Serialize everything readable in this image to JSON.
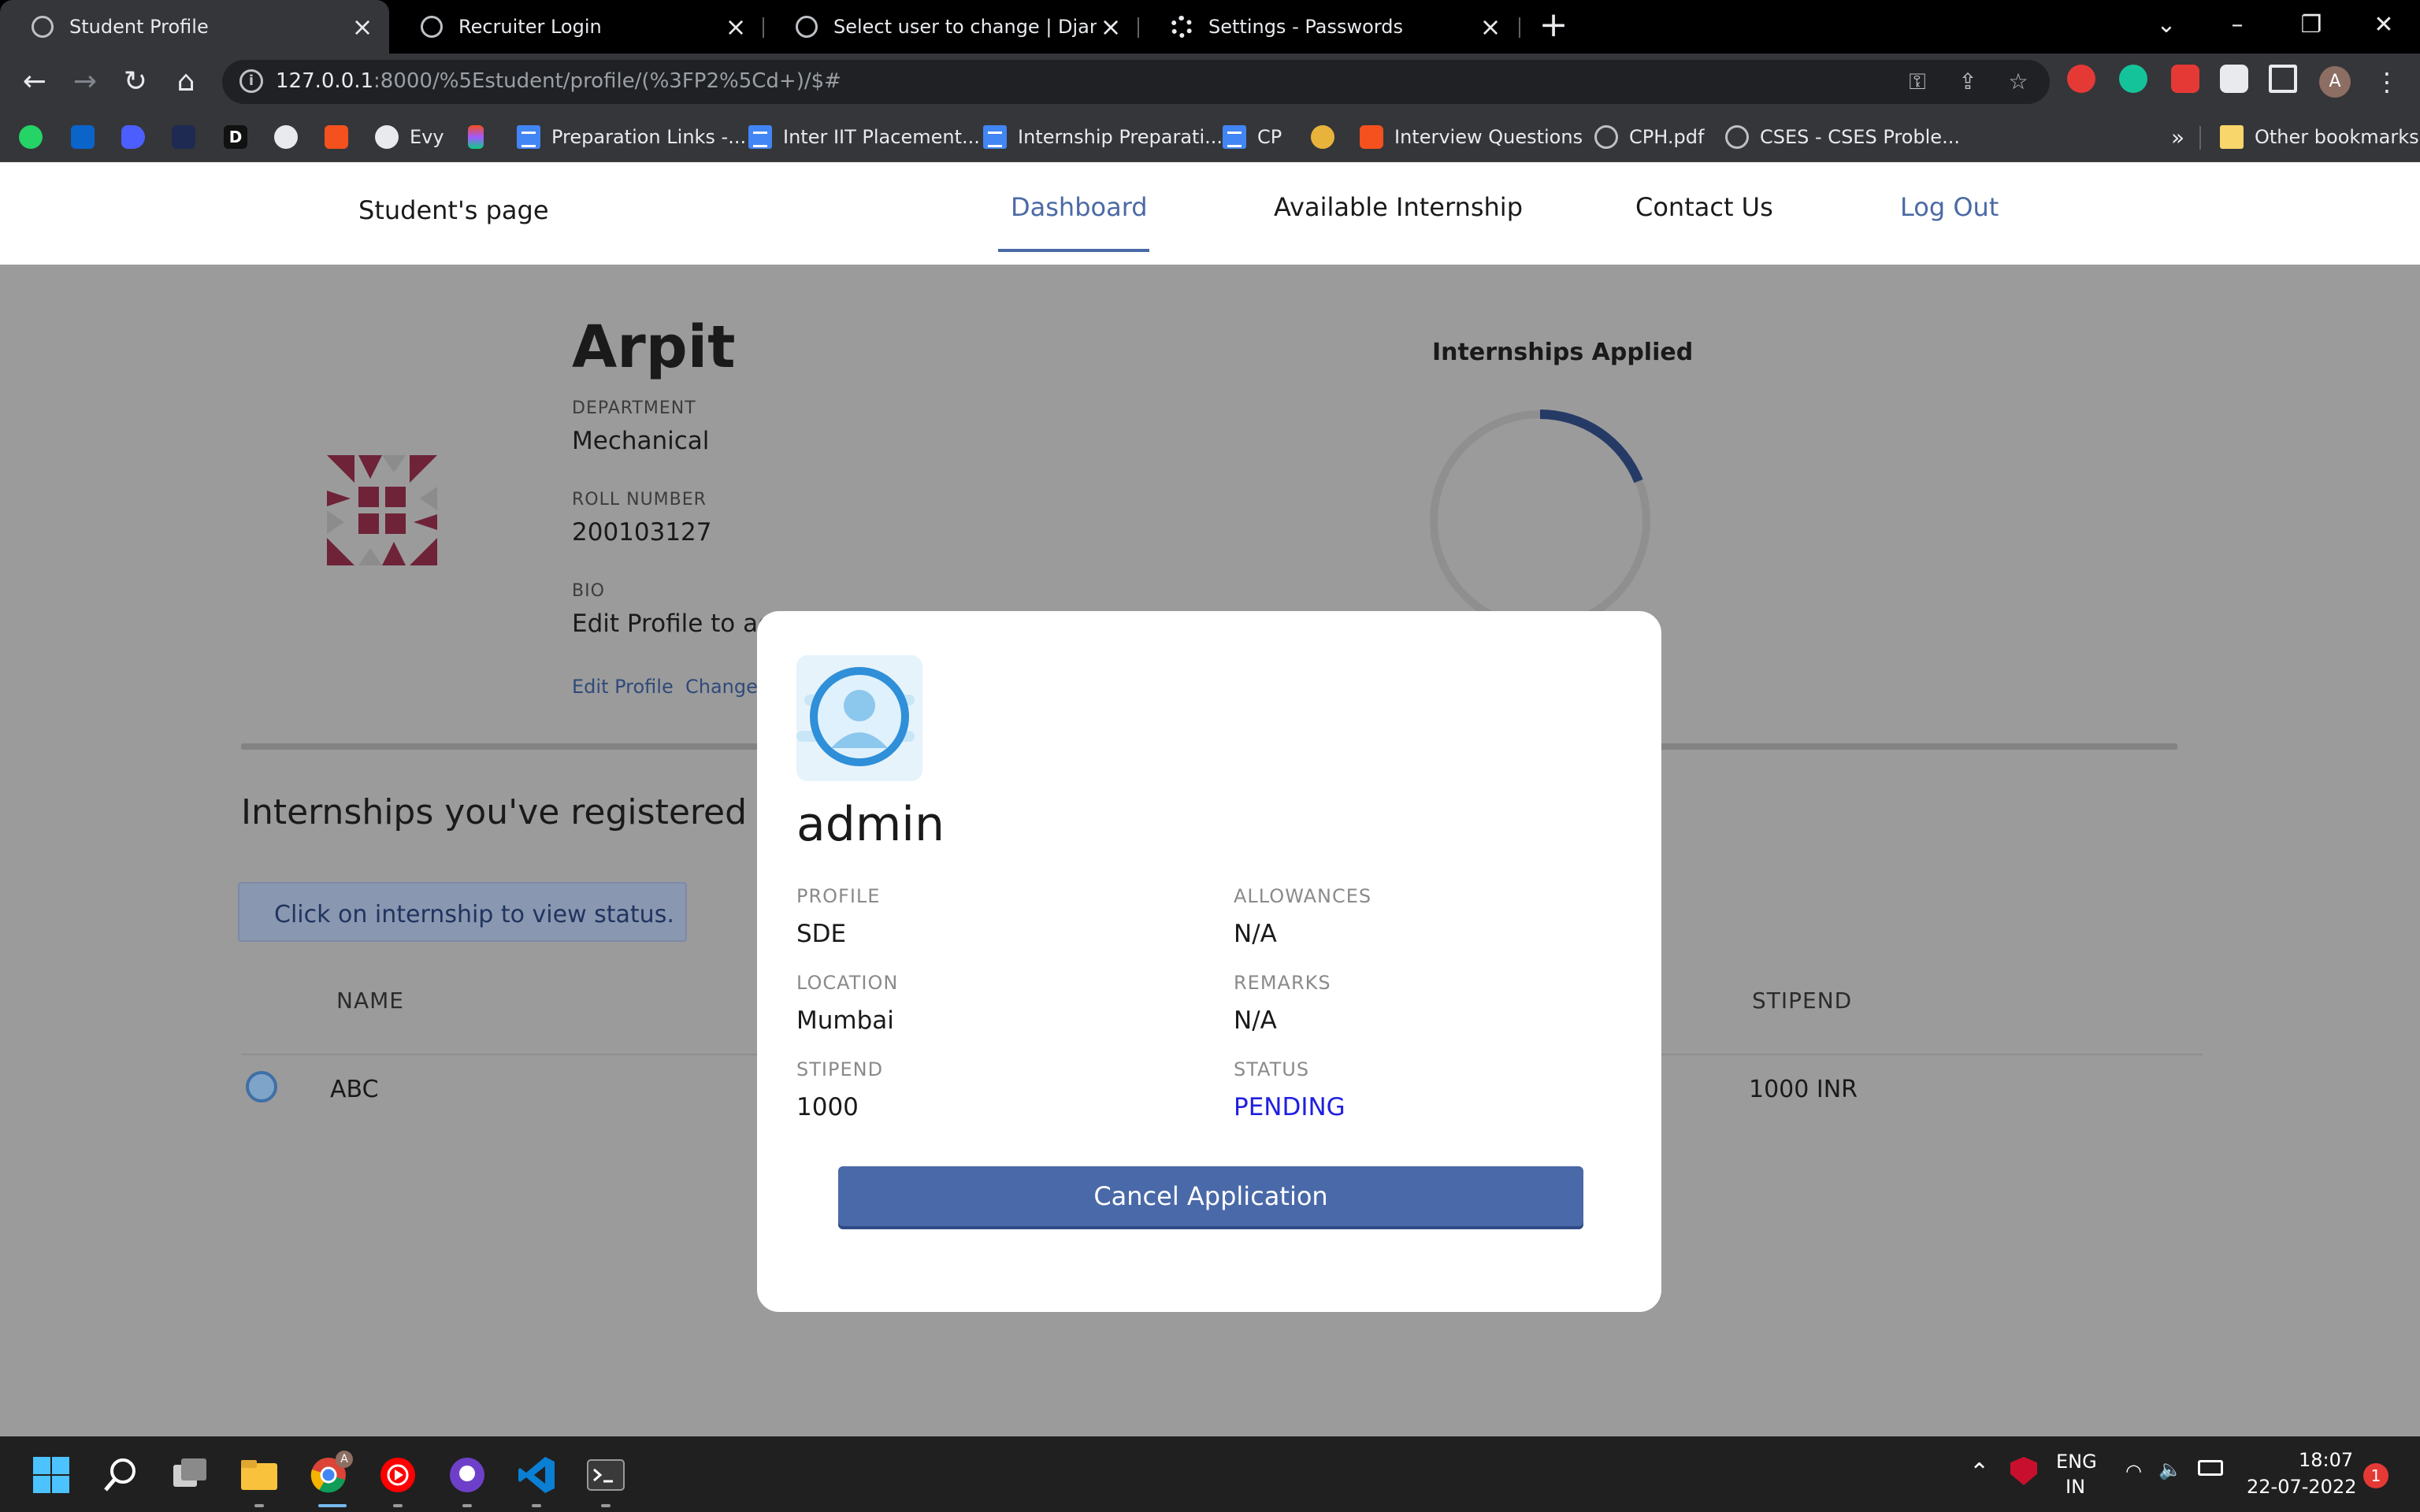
{
  "browser": {
    "tabs": [
      {
        "title": "Student Profile",
        "active": true
      },
      {
        "title": "Recruiter Login",
        "active": false
      },
      {
        "title": "Select user to change | Django si",
        "active": false
      },
      {
        "title": "Settings - Passwords",
        "active": false
      }
    ],
    "url_host": "127.0.0.1",
    "url_path": ":8000/%5Estudent/profile/(%3FP2%5Cd+)/$#",
    "bookmarks": [
      {
        "label": "",
        "icon": "whatsapp-icon"
      },
      {
        "label": "",
        "icon": "outlook-icon"
      },
      {
        "label": "",
        "icon": "bookmark-app-icon"
      },
      {
        "label": "",
        "icon": "dark-app-icon"
      },
      {
        "label": "",
        "icon": "d-app-icon"
      },
      {
        "label": "",
        "icon": "github-icon"
      },
      {
        "label": "",
        "icon": "codeforces-icon"
      },
      {
        "label": "Evy",
        "icon": "github-icon"
      },
      {
        "label": "",
        "icon": "figma-icon"
      },
      {
        "label": "Preparation Links -...",
        "icon": "docs-icon"
      },
      {
        "label": "Inter IIT Placement...",
        "icon": "docs-icon"
      },
      {
        "label": "Internship Preparati...",
        "icon": "docs-icon"
      },
      {
        "label": "CP",
        "icon": "docs-icon"
      },
      {
        "label": "",
        "icon": "flame-icon"
      },
      {
        "label": "Interview Questions",
        "icon": "codeforces-icon"
      },
      {
        "label": "CPH.pdf",
        "icon": "globe-icon"
      },
      {
        "label": "CSES - CSES Proble...",
        "icon": "globe-icon"
      }
    ],
    "overflow_label": "»",
    "other_bookmarks": "Other bookmarks",
    "avatar_letter": "A"
  },
  "navbar": {
    "brand": "Student's page",
    "links": [
      {
        "label": "Dashboard",
        "active": true
      },
      {
        "label": "Available Internship",
        "active": false
      },
      {
        "label": "Contact Us",
        "active": false
      },
      {
        "label": "Log Out",
        "active": false
      }
    ]
  },
  "profile": {
    "name": "Arpit",
    "department_label": "DEPARTMENT",
    "department": "Mechanical",
    "roll_label": "ROLL NUMBER",
    "roll": "200103127",
    "bio_label": "BIO",
    "bio": "Edit Profile to ad",
    "edit_link": "Edit Profile",
    "change_link": "Change"
  },
  "chart": {
    "title": "Internships Applied"
  },
  "registered": {
    "heading": "Internships you've registered fo",
    "hint": "Click on internship to view status.",
    "columns": [
      "NAME",
      "STIPEND"
    ],
    "rows": [
      {
        "name": "ABC",
        "stipend": "1000 INR"
      }
    ]
  },
  "modal": {
    "username": "admin",
    "fields": {
      "profile_label": "PROFILE",
      "profile": "SDE",
      "allowances_label": "ALLOWANCES",
      "allowances": "N/A",
      "location_label": "LOCATION",
      "location": "Mumbai",
      "remarks_label": "REMARKS",
      "remarks": "N/A",
      "stipend_label": "STIPEND",
      "stipend": "1000",
      "status_label": "STATUS",
      "status": "PENDING"
    },
    "cancel_button": "Cancel Application",
    "colors": {
      "accent": "#4a69a8",
      "status_pending": "#1f1fe0"
    }
  },
  "taskbar": {
    "apps": [
      "windows-start-icon",
      "search-icon",
      "task-view-icon",
      "file-explorer-icon",
      "chrome-icon",
      "youtube-music-icon",
      "github-desktop-icon",
      "vscode-icon",
      "terminal-icon"
    ],
    "language": "ENG",
    "region": "IN",
    "time": "18:07",
    "date": "22-07-2022",
    "notifications": "1"
  }
}
